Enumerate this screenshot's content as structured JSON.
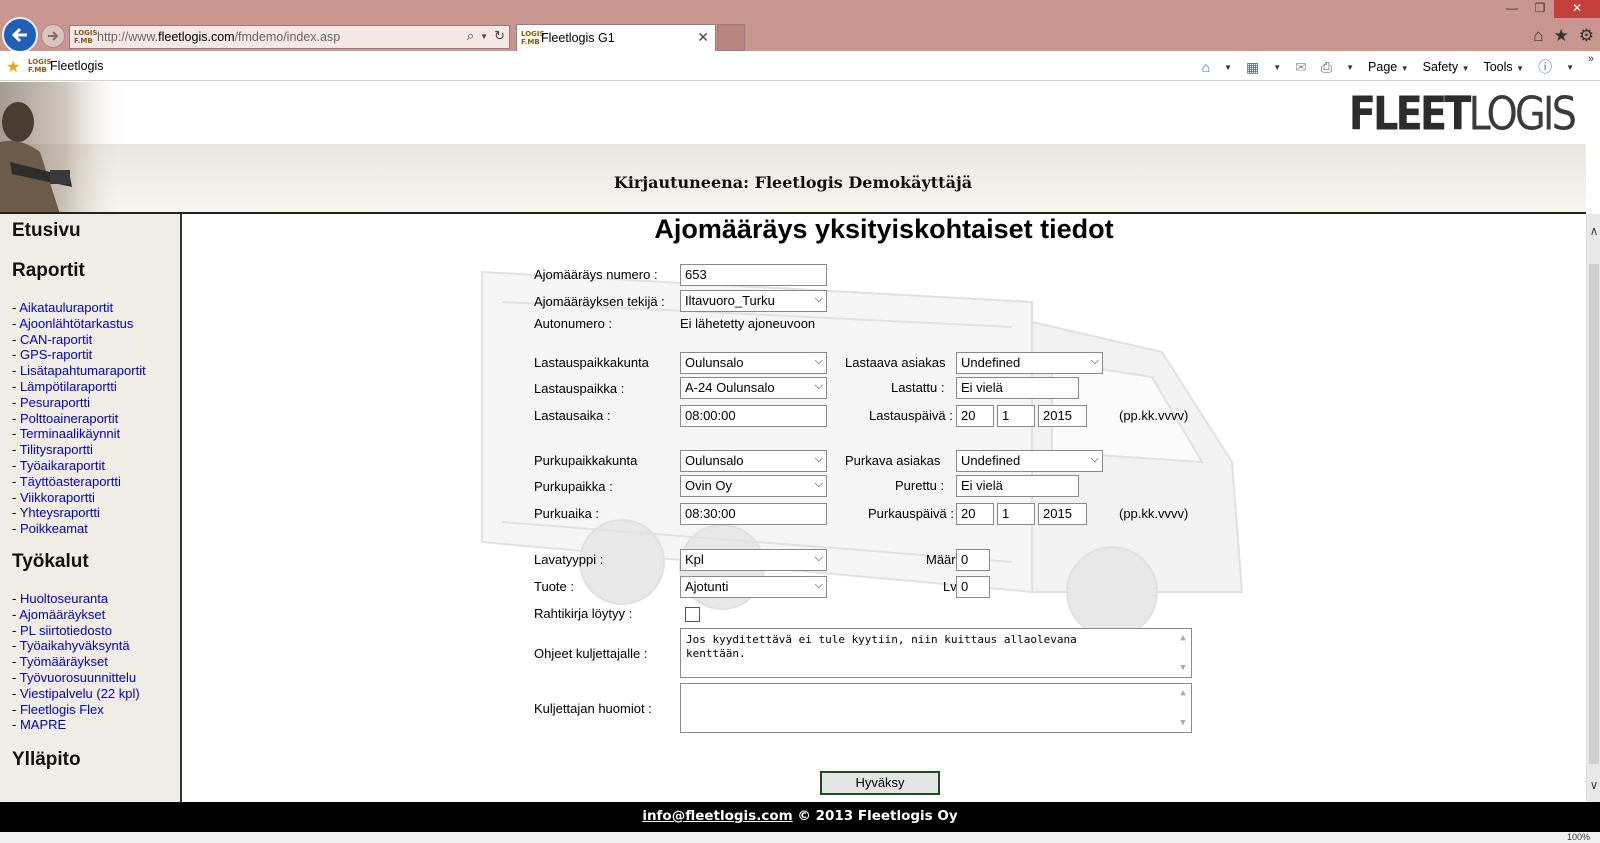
{
  "browser": {
    "url_prefix": "http://www.",
    "url_domain": "fleetlogis.com",
    "url_path": "/fmdemo/index.asp",
    "tab_title": "Fleetlogis G1",
    "favorite_label": "Fleetlogis",
    "favicon_text": "LOGIS F.MB",
    "commands": {
      "page": "Page",
      "safety": "Safety",
      "tools": "Tools"
    },
    "zoom": "100%"
  },
  "header": {
    "logo_bold": "FLEET",
    "logo_light": "LOGIS",
    "login_text": "Kirjautuneena: Fleetlogis Demokäyttäjä"
  },
  "sidebar": {
    "home": "Etusivu",
    "reports_heading": "Raportit",
    "reports": [
      "Aikataulu­raportit",
      "Ajoonlähtötarkastus",
      "CAN-raportit",
      "GPS-raportit",
      "Lisätapahtumaraportit",
      "Lämpötilaraportti",
      "Pesuraportti",
      "Polttoaineraportit",
      "Terminaalikäynnit",
      "Tilitysraportti",
      "Työaikaraportit",
      "Täyttöasteraportti",
      "Viikkoraportti",
      "Yhteysraportti",
      "Poikkeamat"
    ],
    "tools_heading": "Työkalut",
    "tools": [
      "Huoltoseuranta",
      "Ajomääräykset",
      "PL siirtotiedosto",
      "Työaikahyväksyntä",
      "Työmääräykset",
      "Työvuorosuunnittelu",
      "Viestipalvelu (22 kpl)",
      "Fleetlogis Flex",
      "MAPRE"
    ],
    "admin_heading": "Ylläpito"
  },
  "form": {
    "title": "Ajomääräys yksityiskohtaiset tiedot",
    "order_number_label": "Ajomääräys numero :",
    "order_number": "653",
    "creator_label": "Ajomääräyksen tekijä :",
    "creator": "Iltavuoro_Turku",
    "vehicle_label": "Autonumero :",
    "vehicle_value": "Ei lähetetty ajoneuvoon",
    "loading_city_label": "Lastauspaikkakunta",
    "loading_city": "Oulunsalo",
    "loading_customer_label": "Lastaava asiakas",
    "loading_customer": "Undefined",
    "loading_place_label": "Lastauspaikka :",
    "loading_place": "A-24 Oulunsalo",
    "loaded_label": "Lastattu :",
    "loaded": "Ei vielä",
    "loading_time_label": "Lastausaika :",
    "loading_time": "08:00:00",
    "loading_date_label": "Lastauspäivä :",
    "loading_date_day": "20",
    "loading_date_month": "1",
    "loading_date_year": "2015",
    "date_format_hint": "(pp.kk.vvvv)",
    "unloading_city_label": "Purkupaikkakunta",
    "unloading_city": "Oulunsalo",
    "unloading_customer_label": "Purkava asiakas",
    "unloading_customer": "Undefined",
    "unloading_place_label": "Purkupaikka :",
    "unloading_place": "Ovin Oy",
    "unloaded_label": "Purettu :",
    "unloaded": "Ei vielä",
    "unloading_time_label": "Purkuaika :",
    "unloading_time": "08:30:00",
    "unloading_date_label": "Purkauspäivä :",
    "unloading_date_day": "20",
    "unloading_date_month": "1",
    "unloading_date_year": "2015",
    "pallet_type_label": "Lavatyyppi :",
    "pallet_type": "Kpl",
    "quantity_label": "Määrä :",
    "quantity": "0",
    "product_label": "Tuote :",
    "product": "Ajotunti",
    "lvp_label": "Lvp :",
    "lvp": "0",
    "waybill_label": "Rahtikirja löytyy :",
    "driver_instructions_label": "Ohjeet kuljettajalle :",
    "driver_instructions": "Jos kyyditettävä ei tule kyytiin, niin kuittaus allaolevana\nkenttään.",
    "driver_notes_label": "Kuljettajan huomiot :",
    "driver_notes": "",
    "submit_label": "Hyväksy"
  },
  "footer": {
    "email": "info@fleetlogis.com",
    "copyright": "© 2013 Fleetlogis Oy"
  }
}
